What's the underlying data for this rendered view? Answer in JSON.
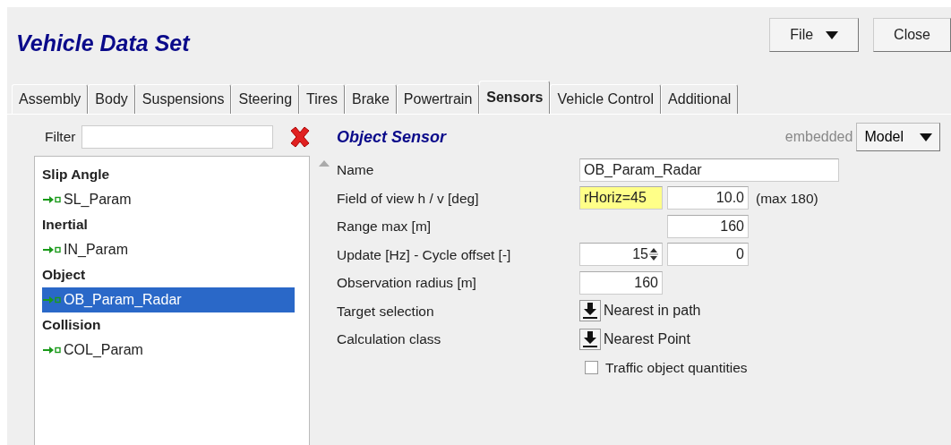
{
  "window": {
    "title": "Vehicle Data Set"
  },
  "buttons": [
    {
      "label": "File",
      "kind": "menu"
    },
    {
      "label": "Close",
      "kind": "plain"
    }
  ],
  "tabs": [
    {
      "label": "Assembly",
      "selected": false
    },
    {
      "label": "Body",
      "selected": false
    },
    {
      "label": "Suspensions",
      "selected": false
    },
    {
      "label": "Steering",
      "selected": false
    },
    {
      "label": "Tires",
      "selected": false
    },
    {
      "label": "Brake",
      "selected": false
    },
    {
      "label": "Powertrain",
      "selected": false
    },
    {
      "label": "Sensors",
      "selected": true
    },
    {
      "label": "Vehicle Control",
      "selected": false
    },
    {
      "label": "Additional",
      "selected": false
    }
  ],
  "filter": {
    "label": "Filter"
  },
  "tree": [
    {
      "label": "Slip Angle",
      "children": [
        {
          "label": "SL_Param",
          "selected": false
        }
      ]
    },
    {
      "label": "Inertial",
      "children": [
        {
          "label": "IN_Param",
          "selected": false
        }
      ]
    },
    {
      "label": "Object",
      "children": [
        {
          "label": "OB_Param_Radar",
          "selected": true
        }
      ]
    },
    {
      "label": "Collision",
      "children": [
        {
          "label": "COL_Param",
          "selected": false
        }
      ]
    }
  ],
  "section": {
    "title": "Object Sensor",
    "mode_label": "embedded",
    "mode": "Model"
  },
  "rows": [
    {
      "kind": "wide",
      "label": "Name",
      "value": "OB_Param_Radar"
    },
    {
      "kind": "pair",
      "label": "Field of view h / v [deg]",
      "value": "rHoriz=45",
      "highlighted": true,
      "value2": "10.0",
      "note": "(max 180)"
    },
    {
      "kind": "second",
      "label": "Range max [m]",
      "value2": "160"
    },
    {
      "kind": "spin_pair",
      "label": "Update [Hz] - Cycle offset [-]",
      "value": "15",
      "value2": "0"
    },
    {
      "kind": "single",
      "label": "Observation radius [m]",
      "value": "160"
    },
    {
      "kind": "choice",
      "label": "Target selection",
      "value": "Nearest in path"
    },
    {
      "kind": "choice",
      "label": "Calculation class",
      "value": "Nearest Point"
    },
    {
      "kind": "checkbox",
      "label": "Traffic object quantities",
      "checked": false
    }
  ]
}
